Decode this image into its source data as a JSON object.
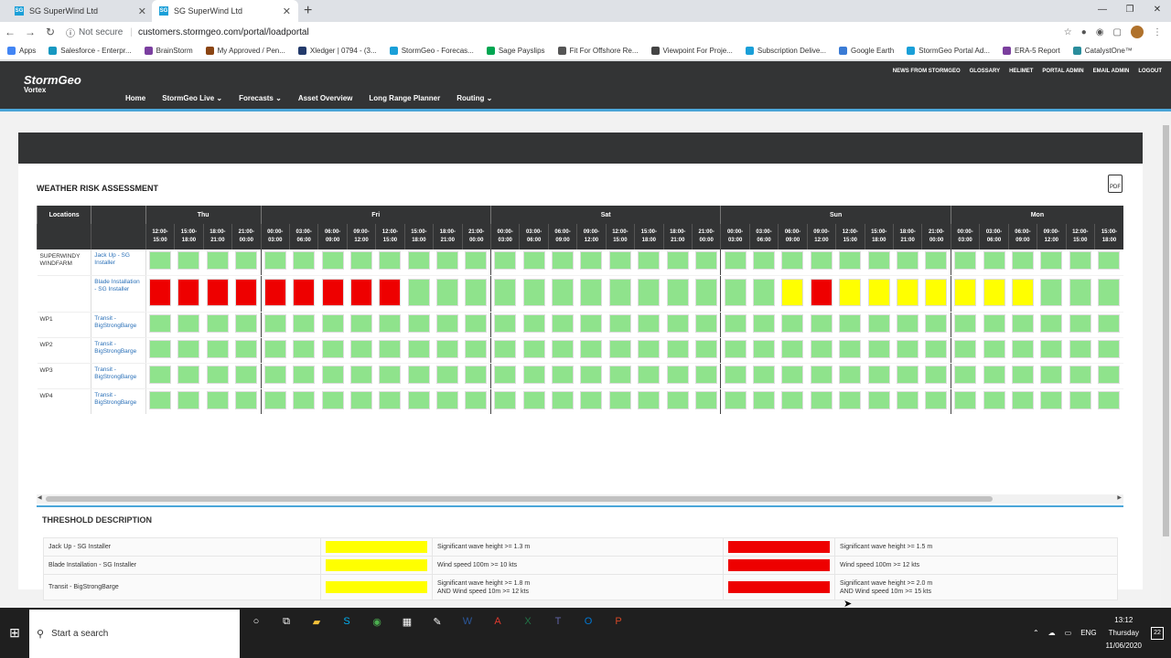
{
  "browser": {
    "tabs": [
      {
        "title": "SG SuperWind Ltd",
        "favicon": "SG",
        "active": false
      },
      {
        "title": "SG SuperWind Ltd",
        "favicon": "SG",
        "active": true
      }
    ],
    "security_label": "Not secure",
    "url": "customers.stormgeo.com/portal/loadportal",
    "bookmarks": [
      {
        "label": "Apps",
        "color": "#4285f4"
      },
      {
        "label": "Salesforce - Enterpr...",
        "color": "#1798c1"
      },
      {
        "label": "BrainStorm",
        "color": "#7b3fa0"
      },
      {
        "label": "My Approved / Pen...",
        "color": "#8b4513"
      },
      {
        "label": "Xledger | 0794 - (3...",
        "color": "#233a6b"
      },
      {
        "label": "StormGeo - Forecas...",
        "color": "#1a9fd8"
      },
      {
        "label": "Sage Payslips",
        "color": "#00a651"
      },
      {
        "label": "Fit For Offshore Re...",
        "color": "#555555"
      },
      {
        "label": "Viewpoint For Proje...",
        "color": "#444444"
      },
      {
        "label": "Subscription Delive...",
        "color": "#1a9fd8"
      },
      {
        "label": "Google Earth",
        "color": "#3a7bd5"
      },
      {
        "label": "StormGeo Portal Ad...",
        "color": "#1a9fd8"
      },
      {
        "label": "ERA-5 Report",
        "color": "#7b3f9e"
      },
      {
        "label": "CatalystOne™",
        "color": "#2a8d9c"
      }
    ]
  },
  "site": {
    "logo_main": "StormGeo",
    "logo_sub": "Vortex",
    "main_nav": [
      {
        "label": "Home",
        "dropdown": false
      },
      {
        "label": "StormGeo Live",
        "dropdown": true
      },
      {
        "label": "Forecasts",
        "dropdown": true
      },
      {
        "label": "Asset Overview",
        "dropdown": false
      },
      {
        "label": "Long Range Planner",
        "dropdown": false
      },
      {
        "label": "Routing",
        "dropdown": true
      }
    ],
    "top_nav": [
      "NEWS FROM STORMGEO",
      "GLOSSARY",
      "HELIMET",
      "PORTAL ADMIN",
      "EMAIL ADMIN",
      "LOGOUT"
    ]
  },
  "risk": {
    "title": "WEATHER RISK ASSESSMENT",
    "header_locations": "Locations",
    "colors": {
      "G": "#8fe38c",
      "R": "#ee0000",
      "Y": "#ffff00"
    },
    "days": [
      {
        "label": "Thu",
        "times": [
          "12:00-15:00",
          "15:00-18:00",
          "18:00-21:00",
          "21:00-00:00"
        ]
      },
      {
        "label": "Fri",
        "times": [
          "00:00-03:00",
          "03:00-06:00",
          "06:00-09:00",
          "09:00-12:00",
          "12:00-15:00",
          "15:00-18:00",
          "18:00-21:00",
          "21:00-00:00"
        ]
      },
      {
        "label": "Sat",
        "times": [
          "00:00-03:00",
          "03:00-06:00",
          "06:00-09:00",
          "09:00-12:00",
          "12:00-15:00",
          "15:00-18:00",
          "18:00-21:00",
          "21:00-00:00"
        ]
      },
      {
        "label": "Sun",
        "times": [
          "00:00-03:00",
          "03:00-06:00",
          "06:00-09:00",
          "09:00-12:00",
          "12:00-15:00",
          "15:00-18:00",
          "18:00-21:00",
          "21:00-00:00"
        ]
      },
      {
        "label": "Mon",
        "times": [
          "00:00-03:00",
          "03:00-06:00",
          "06:00-09:00",
          "09:00-12:00",
          "12:00-15:00",
          "15:00-18:00"
        ]
      }
    ],
    "rows": [
      {
        "location": "SUPERWINDY WINDFARM",
        "asset": "Jack Up - SG Installer",
        "tall": false,
        "cells": "GGGGGGGGGGGGGGGGGGGGGGGGGGGGGGGGGG"
      },
      {
        "location": "",
        "asset": "Blade Installation - SG Installer",
        "tall": true,
        "cells": "RRRRRRRRRGGGGGGGGGGGGGYRYYYYYYYGGGGGG"
      },
      {
        "location": "WP1",
        "asset": "Transit - BigStrongBarge",
        "tall": false,
        "cells": "GGGGGGGGGGGGGGGGGGGGGGGGGGGGGGGGGG"
      },
      {
        "location": "WP2",
        "asset": "Transit - BigStrongBarge",
        "tall": false,
        "cells": "GGGGGGGGGGGGGGGGGGGGGGGGGGGGGGGGGG"
      },
      {
        "location": "WP3",
        "asset": "Transit - BigStrongBarge",
        "tall": false,
        "cells": "GGGGGGGGGGGGGGGGGGGGGGGGGGGGGGGGGG"
      },
      {
        "location": "WP4",
        "asset": "Transit - BigStrongBarge",
        "tall": false,
        "cells": "GGGGGGGGGGGGGGGGGGGGGGGGGGGGGGGGGG"
      }
    ]
  },
  "thresholds": {
    "title": "THRESHOLD DESCRIPTION",
    "rows": [
      {
        "name": "Jack Up - SG Installer",
        "yellow": "Significant wave height >= 1.3 m",
        "red": "Significant wave height >= 1.5 m"
      },
      {
        "name": "Blade Installation - SG Installer",
        "yellow": "Wind speed 100m >= 10 kts",
        "red": "Wind speed 100m >= 12 kts"
      },
      {
        "name": "Transit - BigStrongBarge",
        "yellow": "Significant wave height >= 1.8 m\nAND Wind speed 10m >= 12 kts",
        "red": "Significant wave height >= 2.0 m\nAND Wind speed 10m >= 15 kts"
      }
    ]
  },
  "taskbar": {
    "search_placeholder": "Start a search",
    "lang": "ENG",
    "time": "13:12",
    "day": "Thursday",
    "date": "11/06/2020",
    "notifications": "22"
  }
}
